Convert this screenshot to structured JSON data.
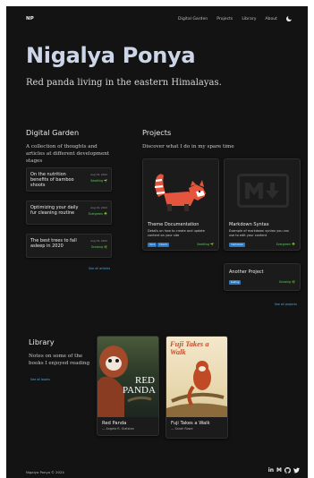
{
  "nav": {
    "brand": "NP",
    "links": [
      "Digital Garden",
      "Projects",
      "Library",
      "About"
    ]
  },
  "hero": {
    "title": "Nigalya Ponya",
    "subtitle": "Red panda living in the eastern Himalayas."
  },
  "garden": {
    "title": "Digital Garden",
    "description": "A collection of thoughts and articles at different development stages",
    "items": [
      {
        "title": "On the nutrition benefits of bamboo shoots",
        "date": "Aug 19, 2022",
        "status": "Seedling 🌱"
      },
      {
        "title": "Optimizing your daily fur cleaning routine",
        "date": "Aug 19, 2022",
        "status": "Evergreen 🌳"
      },
      {
        "title": "The best trees to fall asleep in 2020",
        "date": "Aug 19, 2022",
        "status": "Growing 🌿"
      }
    ],
    "more_link": "See all articles"
  },
  "projects": {
    "title": "Projects",
    "description": "Discover what I do in my spare time",
    "items": [
      {
        "title": "Theme Documentation",
        "description": "Details on how to create and update content on your site",
        "status": "Seedling 🌱",
        "tags": [
          "docs",
          "how-to"
        ]
      },
      {
        "title": "Markdown Syntax",
        "description": "Example of markdown syntax you can use to edit your content",
        "status": "Evergreen 🌳",
        "tags": [
          "markdown"
        ]
      },
      {
        "title": "Another Project",
        "description": "",
        "status": "Growing 🌿",
        "tags": [
          "testing"
        ]
      }
    ],
    "more_link": "See all projects"
  },
  "library": {
    "title": "Library",
    "description": "Notes on some of the books I enjoyed reading",
    "more_link": "See all books",
    "books": [
      {
        "title": "Red Panda",
        "author": "— Angela R. Glatston",
        "cover_text": "RED PANDA"
      },
      {
        "title": "Fuji Takes a Walk",
        "author": "— Sarah Rowe",
        "cover_text": "Fuji Takes a Walk"
      }
    ]
  },
  "footer": {
    "copyright": "Nigalya Ponya © 2024",
    "socials": [
      "in",
      "M",
      "github-icon",
      "twitter-icon"
    ]
  },
  "colors": {
    "background": "#131313",
    "card": "#1b1b1b",
    "accent": "#4aa9e9",
    "tag": "#2878c8",
    "status": "#57d15a",
    "hero_title": "#cdd6e8"
  }
}
